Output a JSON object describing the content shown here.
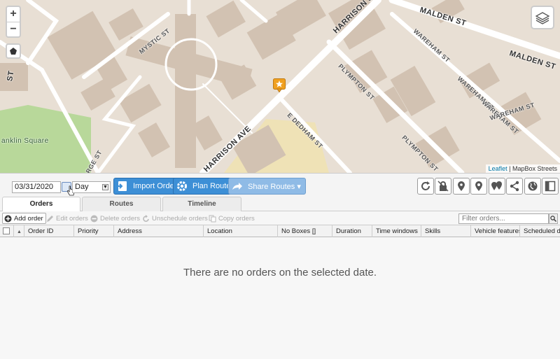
{
  "map": {
    "street_labels": [
      "HARRISON ST",
      "MALDEN ST",
      "MALDEN ST",
      "MYSTIC ST",
      "WAREHAM ST",
      "WAREHAM ST",
      "WAREHAM ST",
      "WAREHAM ST",
      "PLYMPTON ST",
      "PLYMPTON ST",
      "E DEDHAM ST",
      "HARRISON AVE",
      "ST",
      "RGE ST",
      "anklin Square"
    ],
    "attribution_link": "Leaflet",
    "attribution_text": "| MapBox Streets",
    "zoom_in": "+",
    "zoom_out": "−"
  },
  "toolbar": {
    "date_value": "03/31/2020",
    "period_value": "Day",
    "import_orders": "Import Orders",
    "plan_routes": "Plan Routes",
    "share_routes": "Share Routes ▾",
    "accent_color": "#3d8fd6"
  },
  "tabs": [
    "Orders",
    "Routes",
    "Timeline"
  ],
  "actions": {
    "add_order": "Add order",
    "edit_orders": "Edit orders",
    "delete_orders": "Delete orders",
    "unschedule_orders": "Unschedule orders",
    "copy_orders": "Copy orders",
    "filter_placeholder": "Filter orders..."
  },
  "table": {
    "columns": [
      "Order ID",
      "Priority",
      "Address",
      "Location",
      "No Boxes []",
      "Duration",
      "Time windows",
      "Skills",
      "Vehicle features",
      "Scheduled dr"
    ],
    "empty_message": "There are no orders on the selected date."
  },
  "icon_buttons": [
    "refresh-icon",
    "lock-icon",
    "marker-pin-icon",
    "pin-icon",
    "multi-pin-icon",
    "share-icon",
    "globe-icon",
    "panel-toggle-icon"
  ]
}
